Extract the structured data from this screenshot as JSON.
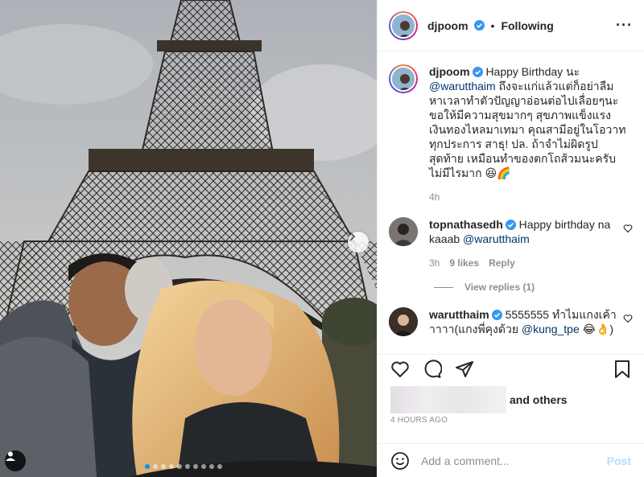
{
  "post": {
    "username": "djpoom",
    "verified": true,
    "follow_status": "Following",
    "more_icon": "more-horizontal-icon"
  },
  "caption": {
    "username": "djpoom",
    "text_prefix": "Happy Birthday นะ",
    "mention": "@warutthaim",
    "text_suffix": "ถึงจะแก่แล้วแต่ก็อย่าลืมหาเวลาทำตัวปัญญาอ่อนต่อไปเลื่อยๆนะ ขอให้มีความสุขมากๆ สุขภาพแข็งแรง เงินทองไหลมาเทมา คุณสามีอยู่ในโอวาททุกประการ สาธุ! ปล. ถ้าจำไม่ผิดรูปสุดท้าย เหมือนทำของตกโถส้วมนะครับ ไม่มีไรมาก 😆🌈",
    "time": "4h"
  },
  "comments": [
    {
      "username": "topnathasedh",
      "verified": true,
      "text": "Happy birthday na kaaab",
      "mention": "@warutthaim",
      "time": "3h",
      "likes": "9 likes",
      "reply_label": "Reply"
    },
    {
      "username": "warutthaim",
      "verified": true,
      "text": "5555555 ทำไมแกงเค้าาาาา(แกงพี่คุงด้วย",
      "mention": "@kung_tpe",
      "text_suffix": "😂👌)"
    }
  ],
  "view_replies": "View replies (1)",
  "actions": {
    "like_icon": "heart-icon",
    "comment_icon": "comment-icon",
    "share_icon": "paper-plane-icon",
    "save_icon": "bookmark-icon"
  },
  "likes_text": "and others",
  "timestamp": "4 HOURS AGO",
  "add_comment": {
    "placeholder": "Add a comment...",
    "post_label": "Post",
    "emoji_icon": "smile-icon"
  },
  "carousel": {
    "slide_count": 10,
    "active_index": 0
  },
  "colors": {
    "verified": "#3897f0",
    "mention": "#00376b",
    "post_disabled": "#b2dffc",
    "carousel_active": "#0095f6"
  }
}
